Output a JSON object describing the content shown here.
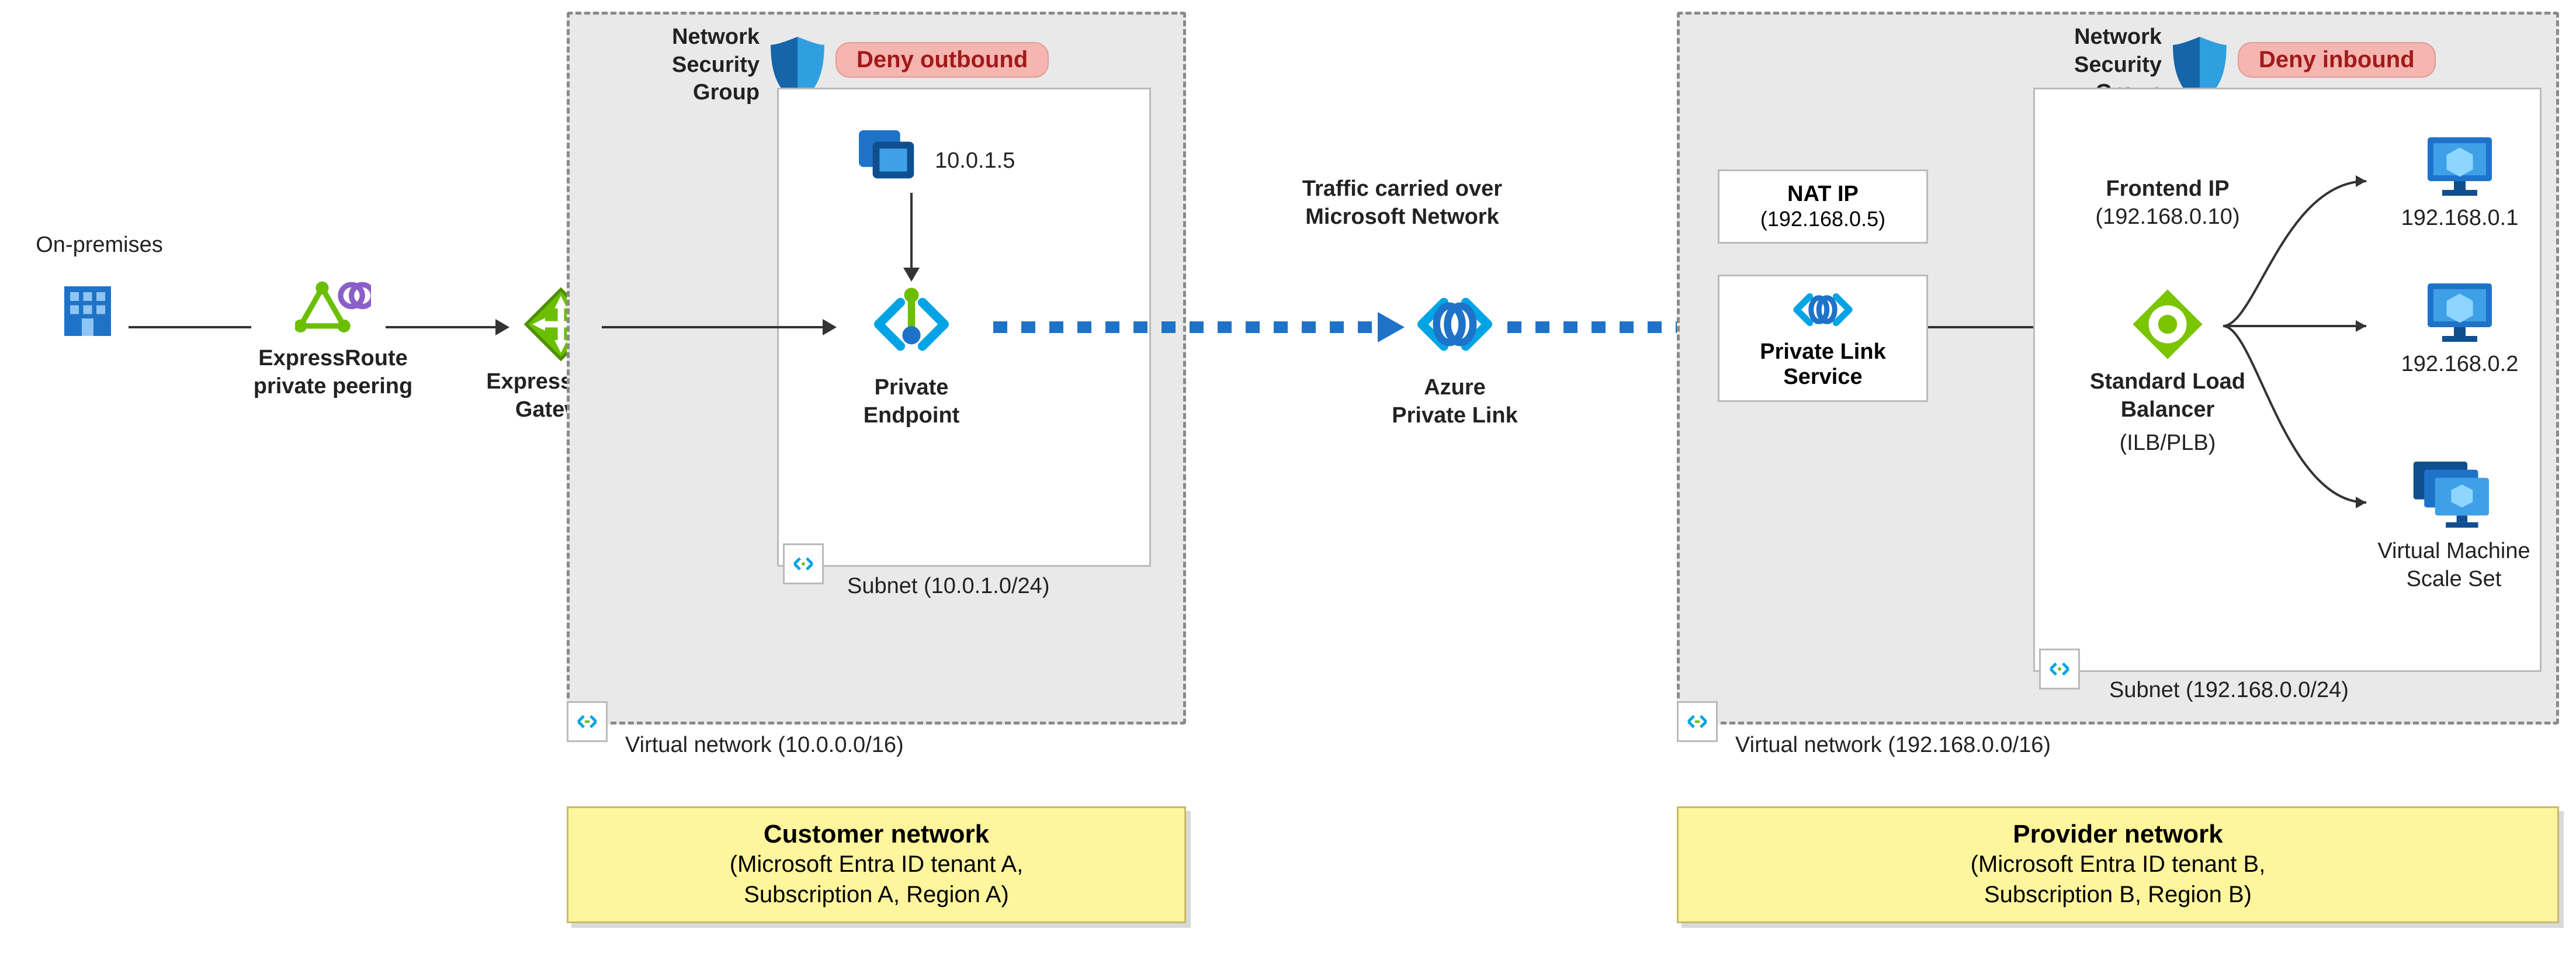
{
  "on_prem_label": "On-premises",
  "expressroute_peering": "ExpressRoute\nprivate peering",
  "expressroute_gateway": "ExpressRoute\nGateway",
  "nsg_label": "Network\nSecurity\nGroup",
  "deny_outbound": "Deny outbound",
  "deny_inbound": "Deny inbound",
  "nic_ip": "10.0.1.5",
  "private_endpoint": "Private\nEndpoint",
  "subnet_customer": "Subnet (10.0.1.0/24)",
  "vnet_customer": "Virtual network (10.0.0.0/16)",
  "traffic_label": "Traffic carried over\nMicrosoft Network",
  "azure_private_link": "Azure\nPrivate Link",
  "nat_ip_label": "NAT IP",
  "nat_ip_value": "(192.168.0.5)",
  "pls_label": "Private Link\nService",
  "frontend_ip_label": "Frontend IP",
  "frontend_ip_value": "(192.168.0.10)",
  "slb_label": "Standard Load\nBalancer",
  "slb_sub": "(ILB/PLB)",
  "vm1_ip": "192.168.0.1",
  "vm2_ip": "192.168.0.2",
  "vmss_label": "Virtual Machine\nScale Set",
  "subnet_provider": "Subnet (192.168.0.0/24)",
  "vnet_provider": "Virtual network (192.168.0.0/16)",
  "customer_title": "Customer network",
  "customer_sub": "(Microsoft Entra ID tenant A,\nSubscription A, Region A)",
  "provider_title": "Provider network",
  "provider_sub": "(Microsoft Entra ID tenant B,\nSubscription B, Region B)",
  "chart_data": {
    "type": "diagram",
    "left_network": {
      "role": "Customer network",
      "tenant": "Microsoft Entra ID tenant A",
      "subscription": "Subscription A",
      "region": "Region A",
      "virtual_network_cidr": "10.0.0.0/16",
      "subnet_cidr": "10.0.1.0/24",
      "nsg_rule": "Deny outbound",
      "private_endpoint_nic_ip": "10.0.1.5"
    },
    "right_network": {
      "role": "Provider network",
      "tenant": "Microsoft Entra ID tenant B",
      "subscription": "Subscription B",
      "region": "Region B",
      "virtual_network_cidr": "192.168.0.0/16",
      "subnet_cidr": "192.168.0.0/24",
      "nsg_rule": "Deny inbound",
      "nat_ip": "192.168.0.5",
      "load_balancer_frontend_ip": "192.168.0.10",
      "vm_ips": [
        "192.168.0.1",
        "192.168.0.2"
      ],
      "backend": "Virtual Machine Scale Set"
    },
    "flow": [
      "On-premises",
      "ExpressRoute private peering",
      "ExpressRoute Gateway",
      "Private Endpoint",
      "Azure Private Link",
      "Private Link Service",
      "Standard Load Balancer (ILB/PLB)",
      "Virtual Machine Scale Set"
    ],
    "traffic_annotation": "Traffic carried over Microsoft Network",
    "traffic_segments_dotted": [
      "Private Endpoint → Azure Private Link",
      "Azure Private Link → Private Link Service"
    ]
  }
}
